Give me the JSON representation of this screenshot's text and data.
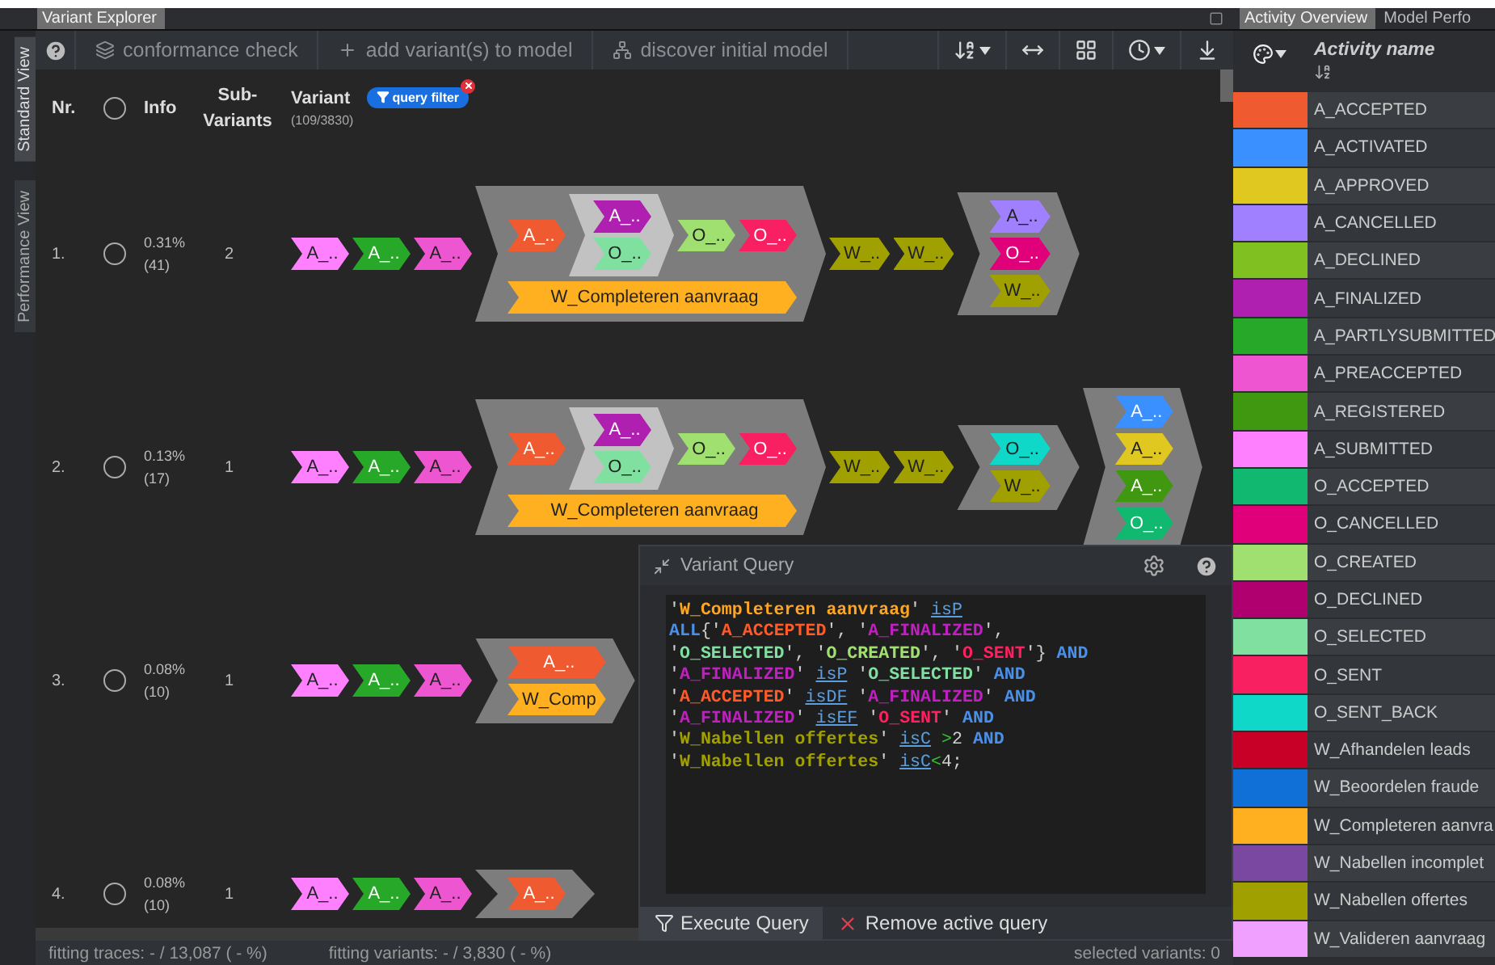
{
  "left_tabs": [
    {
      "label": "Variant Explorer",
      "selected": true
    }
  ],
  "right_tabs": [
    {
      "label": "Activity Overview",
      "selected": true
    },
    {
      "label": "Model Perfo",
      "selected": false
    }
  ],
  "view_tabs": [
    {
      "label": "Standard View",
      "selected": true
    },
    {
      "label": "Performance View",
      "selected": false
    }
  ],
  "toolbar": {
    "buttons": [
      "conformance check",
      "add variant(s) to model",
      "discover initial model"
    ]
  },
  "header": {
    "nr": "Nr.",
    "select_all": {
      "checked": false
    },
    "info": "Info",
    "sub_variants": "Sub-Variants",
    "variant": "Variant",
    "variant_count": "(109/3830)",
    "filter_badge": "query filter"
  },
  "variants": [
    {
      "nr": "1.",
      "checked": false,
      "percent": "0.31%",
      "count": "(41)",
      "sub_variants": "2",
      "elements": [
        {
          "kind": "activity",
          "label": "A_..",
          "color": "#ff80ff"
        },
        {
          "kind": "activity",
          "label": "A_..",
          "color": "#28a828"
        },
        {
          "kind": "activity",
          "label": "A_..",
          "color": "#ee55d0"
        },
        {
          "kind": "parallel",
          "branches": [
            [
              {
                "kind": "activity",
                "label": "A_..",
                "color": "#f05a30"
              },
              {
                "kind": "parallel",
                "branches": [
                  [
                    {
                      "kind": "activity",
                      "label": "A_..",
                      "color": "#b020b0"
                    }
                  ],
                  [
                    {
                      "kind": "activity",
                      "label": "O_..",
                      "color": "#80e0a0"
                    }
                  ]
                ]
              },
              {
                "kind": "activity",
                "label": "O_..",
                "color": "#a0e070"
              },
              {
                "kind": "activity",
                "label": "O_..",
                "color": "#f82060"
              }
            ],
            [
              {
                "kind": "activity",
                "label": "W_Completeren aanvraag",
                "color": "#ffb020"
              }
            ]
          ]
        },
        {
          "kind": "activity",
          "label": "W_..",
          "color": "#a0a000"
        },
        {
          "kind": "activity",
          "label": "W_..",
          "color": "#a0a000"
        },
        {
          "kind": "parallel",
          "branches": [
            [
              {
                "kind": "activity",
                "label": "A_..",
                "color": "#a080ff"
              }
            ],
            [
              {
                "kind": "activity",
                "label": "O_..",
                "color": "#e0007a"
              }
            ],
            [
              {
                "kind": "activity",
                "label": "W_..",
                "color": "#a0a000"
              }
            ]
          ]
        }
      ]
    },
    {
      "nr": "2.",
      "checked": false,
      "percent": "0.13%",
      "count": "(17)",
      "sub_variants": "1",
      "elements": [
        {
          "kind": "activity",
          "label": "A_..",
          "color": "#ff80ff"
        },
        {
          "kind": "activity",
          "label": "A_..",
          "color": "#28a828"
        },
        {
          "kind": "activity",
          "label": "A_..",
          "color": "#ee55d0"
        },
        {
          "kind": "parallel",
          "branches": [
            [
              {
                "kind": "activity",
                "label": "A_..",
                "color": "#f05a30"
              },
              {
                "kind": "parallel",
                "branches": [
                  [
                    {
                      "kind": "activity",
                      "label": "A_..",
                      "color": "#b020b0"
                    }
                  ],
                  [
                    {
                      "kind": "activity",
                      "label": "O_..",
                      "color": "#80e0a0"
                    }
                  ]
                ]
              },
              {
                "kind": "activity",
                "label": "O_..",
                "color": "#a0e070"
              },
              {
                "kind": "activity",
                "label": "O_..",
                "color": "#f82060"
              }
            ],
            [
              {
                "kind": "activity",
                "label": "W_Completeren aanvraag",
                "color": "#ffb020"
              }
            ]
          ]
        },
        {
          "kind": "activity",
          "label": "W_..",
          "color": "#a0a000"
        },
        {
          "kind": "activity",
          "label": "W_..",
          "color": "#a0a000"
        },
        {
          "kind": "parallel",
          "branches": [
            [
              {
                "kind": "activity",
                "label": "O_..",
                "color": "#10d8c8"
              }
            ],
            [
              {
                "kind": "activity",
                "label": "W_..",
                "color": "#a0a000"
              }
            ]
          ]
        },
        {
          "kind": "parallel",
          "branches": [
            [
              {
                "kind": "activity",
                "label": "A_..",
                "color": "#3a90ff"
              }
            ],
            [
              {
                "kind": "activity",
                "label": "A_..",
                "color": "#e0c820"
              }
            ],
            [
              {
                "kind": "activity",
                "label": "A_..",
                "color": "#409810"
              }
            ],
            [
              {
                "kind": "activity",
                "label": "O_..",
                "color": "#10b870"
              }
            ]
          ]
        }
      ]
    },
    {
      "nr": "3.",
      "checked": false,
      "percent": "0.08%",
      "count": "(10)",
      "sub_variants": "1",
      "elements": [
        {
          "kind": "activity",
          "label": "A_..",
          "color": "#ff80ff"
        },
        {
          "kind": "activity",
          "label": "A_..",
          "color": "#28a828"
        },
        {
          "kind": "activity",
          "label": "A_..",
          "color": "#ee55d0"
        },
        {
          "kind": "parallel",
          "branches": [
            [
              {
                "kind": "activity",
                "label": "A_..",
                "color": "#f05a30"
              }
            ],
            [
              {
                "kind": "activity",
                "label": "W_Comp",
                "color": "#ffb020"
              }
            ]
          ]
        }
      ]
    },
    {
      "nr": "4.",
      "checked": false,
      "percent": "0.08%",
      "count": "(10)",
      "sub_variants": "1",
      "elements": [
        {
          "kind": "activity",
          "label": "A_..",
          "color": "#ff80ff"
        },
        {
          "kind": "activity",
          "label": "A_..",
          "color": "#28a828"
        },
        {
          "kind": "activity",
          "label": "A_..",
          "color": "#ee55d0"
        },
        {
          "kind": "parallel",
          "branches": [
            [
              {
                "kind": "activity",
                "label": "A_..",
                "color": "#f05a30"
              }
            ]
          ]
        }
      ]
    }
  ],
  "query": {
    "title": "Variant Query",
    "lines": [
      [
        {
          "kind": "txt",
          "text": "'"
        },
        {
          "kind": "str",
          "text": "W_Completeren aanvraag",
          "color": "#ffa520"
        },
        {
          "kind": "txt",
          "text": "' "
        },
        {
          "kind": "op",
          "text": "isP"
        }
      ],
      [
        {
          "kind": "kw",
          "text": "ALL"
        },
        {
          "kind": "txt",
          "text": "{'"
        },
        {
          "kind": "str",
          "text": "A_ACCEPTED",
          "color": "#ff5a28"
        },
        {
          "kind": "txt",
          "text": "', '"
        },
        {
          "kind": "str",
          "text": "A_FINALIZED",
          "color": "#c020c0"
        },
        {
          "kind": "txt",
          "text": "',"
        }
      ],
      [
        {
          "kind": "txt",
          "text": "'"
        },
        {
          "kind": "str",
          "text": "O_SELECTED",
          "color": "#7fe0a0"
        },
        {
          "kind": "txt",
          "text": "', '"
        },
        {
          "kind": "str",
          "text": "O_CREATED",
          "color": "#a0e070"
        },
        {
          "kind": "txt",
          "text": "', '"
        },
        {
          "kind": "str",
          "text": "O_SENT",
          "color": "#ff2060"
        },
        {
          "kind": "txt",
          "text": "'} "
        },
        {
          "kind": "kw",
          "text": "AND"
        }
      ],
      [
        {
          "kind": "txt",
          "text": "'"
        },
        {
          "kind": "str",
          "text": "A_FINALIZED",
          "color": "#c020c0"
        },
        {
          "kind": "txt",
          "text": "' "
        },
        {
          "kind": "op",
          "text": "isP"
        },
        {
          "kind": "txt",
          "text": " '"
        },
        {
          "kind": "str",
          "text": "O_SELECTED",
          "color": "#7fe0a0"
        },
        {
          "kind": "txt",
          "text": "' "
        },
        {
          "kind": "kw",
          "text": "AND"
        }
      ],
      [
        {
          "kind": "txt",
          "text": "'"
        },
        {
          "kind": "str",
          "text": "A_ACCEPTED",
          "color": "#ff5a28"
        },
        {
          "kind": "txt",
          "text": "' "
        },
        {
          "kind": "op",
          "text": "isDF"
        },
        {
          "kind": "txt",
          "text": " '"
        },
        {
          "kind": "str",
          "text": "A_FINALIZED",
          "color": "#c020c0"
        },
        {
          "kind": "txt",
          "text": "' "
        },
        {
          "kind": "kw",
          "text": "AND"
        }
      ],
      [
        {
          "kind": "txt",
          "text": "'"
        },
        {
          "kind": "str",
          "text": "A_FINALIZED",
          "color": "#c020c0"
        },
        {
          "kind": "txt",
          "text": "' "
        },
        {
          "kind": "op",
          "text": "isEF"
        },
        {
          "kind": "txt",
          "text": " '"
        },
        {
          "kind": "str",
          "text": "O_SENT",
          "color": "#ff2060"
        },
        {
          "kind": "txt",
          "text": "' "
        },
        {
          "kind": "kw",
          "text": "AND"
        }
      ],
      [
        {
          "kind": "txt",
          "text": "'"
        },
        {
          "kind": "str",
          "text": "W_Nabellen offertes",
          "color": "#a0a000"
        },
        {
          "kind": "txt",
          "text": "' "
        },
        {
          "kind": "op",
          "text": "isC"
        },
        {
          "kind": "cmp",
          "text": " >"
        },
        {
          "kind": "txt",
          "text": "2 "
        },
        {
          "kind": "kw",
          "text": "AND"
        }
      ],
      [
        {
          "kind": "txt",
          "text": "'"
        },
        {
          "kind": "str",
          "text": "W_Nabellen offertes",
          "color": "#a0a000"
        },
        {
          "kind": "txt",
          "text": "' "
        },
        {
          "kind": "op",
          "text": "isC"
        },
        {
          "kind": "cmp",
          "text": "<"
        },
        {
          "kind": "txt",
          "text": "4;"
        }
      ]
    ],
    "execute": "Execute Query",
    "remove": "Remove active query"
  },
  "status": {
    "traces": "fitting traces: - / 13,087 ( - %)",
    "variants": "fitting variants: - / 3,830 ( - %)",
    "selected": "selected variants: 0"
  },
  "activity_panel": {
    "column": "Activity name",
    "activities": [
      {
        "name": "A_ACCEPTED",
        "color": "#f05a30"
      },
      {
        "name": "A_ACTIVATED",
        "color": "#3a90ff"
      },
      {
        "name": "A_APPROVED",
        "color": "#e0c820"
      },
      {
        "name": "A_CANCELLED",
        "color": "#a080ff"
      },
      {
        "name": "A_DECLINED",
        "color": "#80c020"
      },
      {
        "name": "A_FINALIZED",
        "color": "#b020b0"
      },
      {
        "name": "A_PARTLYSUBMITTED",
        "color": "#28a828"
      },
      {
        "name": "A_PREACCEPTED",
        "color": "#ee55d0"
      },
      {
        "name": "A_REGISTERED",
        "color": "#409810"
      },
      {
        "name": "A_SUBMITTED",
        "color": "#ff80ff"
      },
      {
        "name": "O_ACCEPTED",
        "color": "#10b870"
      },
      {
        "name": "O_CANCELLED",
        "color": "#e0007a"
      },
      {
        "name": "O_CREATED",
        "color": "#a0e070"
      },
      {
        "name": "O_DECLINED",
        "color": "#b00070"
      },
      {
        "name": "O_SELECTED",
        "color": "#80e0a0"
      },
      {
        "name": "O_SENT",
        "color": "#f82060"
      },
      {
        "name": "O_SENT_BACK",
        "color": "#10d8c8"
      },
      {
        "name": "W_Afhandelen leads",
        "color": "#c80028"
      },
      {
        "name": "W_Beoordelen fraude",
        "color": "#1070d8"
      },
      {
        "name": "W_Completeren aanvra",
        "color": "#ffb020"
      },
      {
        "name": "W_Nabellen incomplet",
        "color": "#7a48a0"
      },
      {
        "name": "W_Nabellen offertes",
        "color": "#a0a000"
      },
      {
        "name": "W_Valideren aanvraag",
        "color": "#f0a0ff"
      }
    ]
  }
}
